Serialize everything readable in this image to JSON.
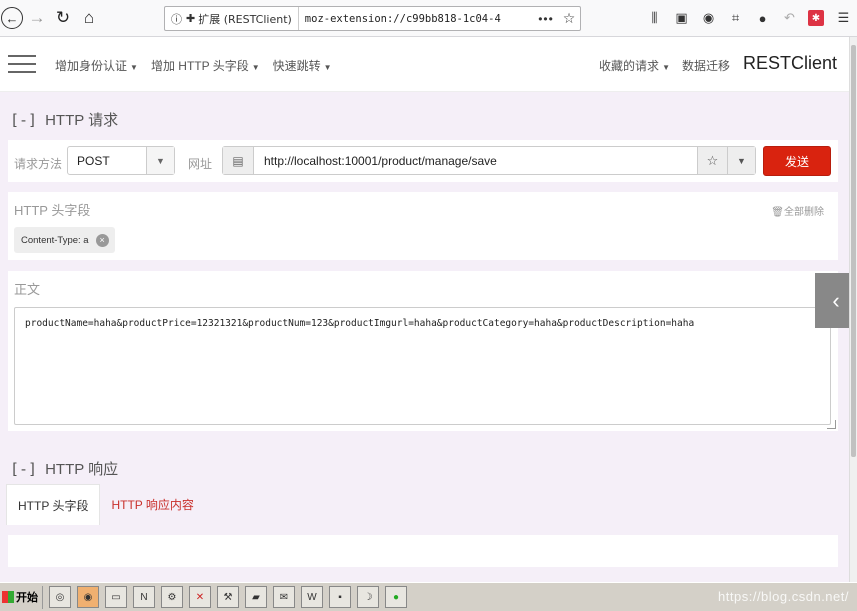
{
  "browser": {
    "identity": "扩展 (RESTClient)",
    "url": "moz-extension://c99bb818-1c04-4",
    "more": "•••"
  },
  "navbar": {
    "menu": [
      "增加身份认证",
      "增加 HTTP 头字段",
      "快速跳转"
    ],
    "right_menu": [
      "收藏的请求",
      "数据迁移"
    ],
    "brand": "RESTClient"
  },
  "request": {
    "section_toggle": "[-]",
    "section_title": "HTTP 请求",
    "method_label": "请求方法",
    "method": "POST",
    "url_label": "网址",
    "url": "http://localhost:10001/product/manage/save",
    "send": "发送"
  },
  "headers": {
    "title": "HTTP 头字段",
    "delete_all": "全部删除",
    "chip": "Content-Type: a"
  },
  "body": {
    "title": "正文",
    "content": "productName=haha&productPrice=12321321&productNum=123&productImgurl=haha&productCategory=haha&productDescription=haha"
  },
  "response": {
    "section_toggle": "[-]",
    "section_title": "HTTP 响应",
    "tabs": [
      "HTTP 头字段",
      "HTTP 响应内容"
    ]
  },
  "taskbar": {
    "start": "开始",
    "watermark": "https://blog.csdn.net/"
  },
  "colors": {
    "send_button": "#d9230f",
    "page_background": "#f5eff8",
    "link_tab": "#c9302c"
  }
}
